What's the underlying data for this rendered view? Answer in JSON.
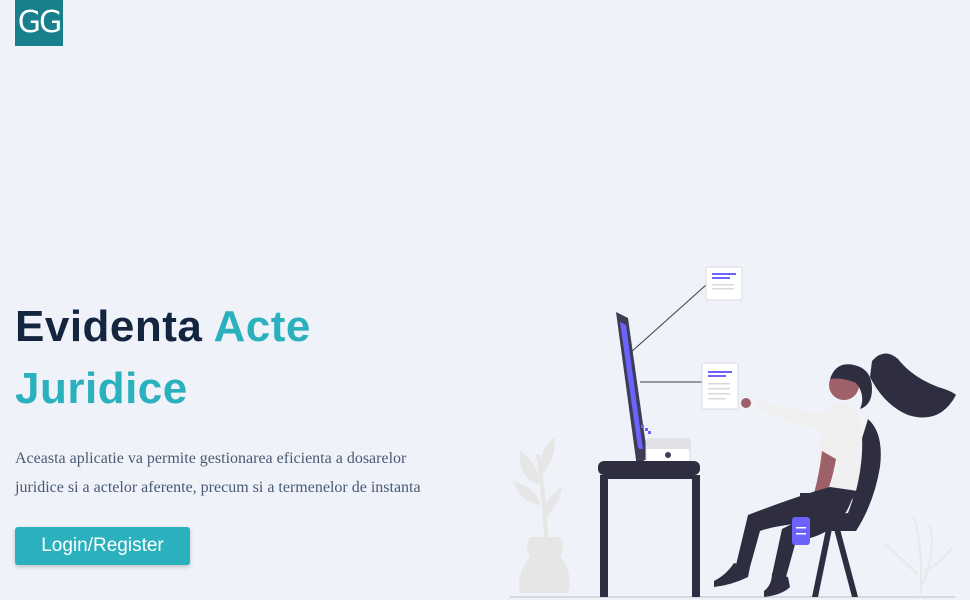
{
  "brand": {
    "logo_text": "GG"
  },
  "hero": {
    "title_part1": "Evidenta ",
    "title_part2": "Acte",
    "title_part3": "Juridice",
    "description_line1": "Aceasta aplicatie va permite gestionarea eficienta a dosarelor",
    "description_line2": "juridice si a actelor aferente, precum si a termenelor de instanta",
    "login_button": "Login/Register"
  },
  "colors": {
    "background": "#eff2f8",
    "navy": "#14263f",
    "accent": "#2bb0bd",
    "logo_bg": "#17808c",
    "illustration_dark": "#2f2e41",
    "illustration_purple": "#6c63ff"
  },
  "illustration": {
    "icon": "woman-at-computer-illustration"
  }
}
